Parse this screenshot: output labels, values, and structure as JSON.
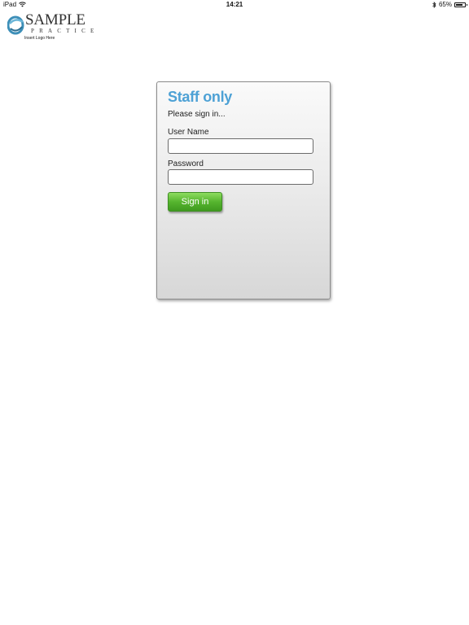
{
  "status_bar": {
    "device": "iPad",
    "time": "14:21",
    "battery_percent": "65%",
    "battery_level": 0.65
  },
  "logo": {
    "word": "SAMPLE",
    "sub": "PRACTICE",
    "tagline": "Insert Logo Here",
    "mark_color": "#3d8fb8"
  },
  "login": {
    "title": "Staff only",
    "subtitle": "Please sign in...",
    "username_label": "User Name",
    "username_value": "",
    "password_label": "Password",
    "password_value": "",
    "submit_label": "Sign in"
  },
  "colors": {
    "title": "#4da1d5",
    "button": "#56b52f"
  }
}
